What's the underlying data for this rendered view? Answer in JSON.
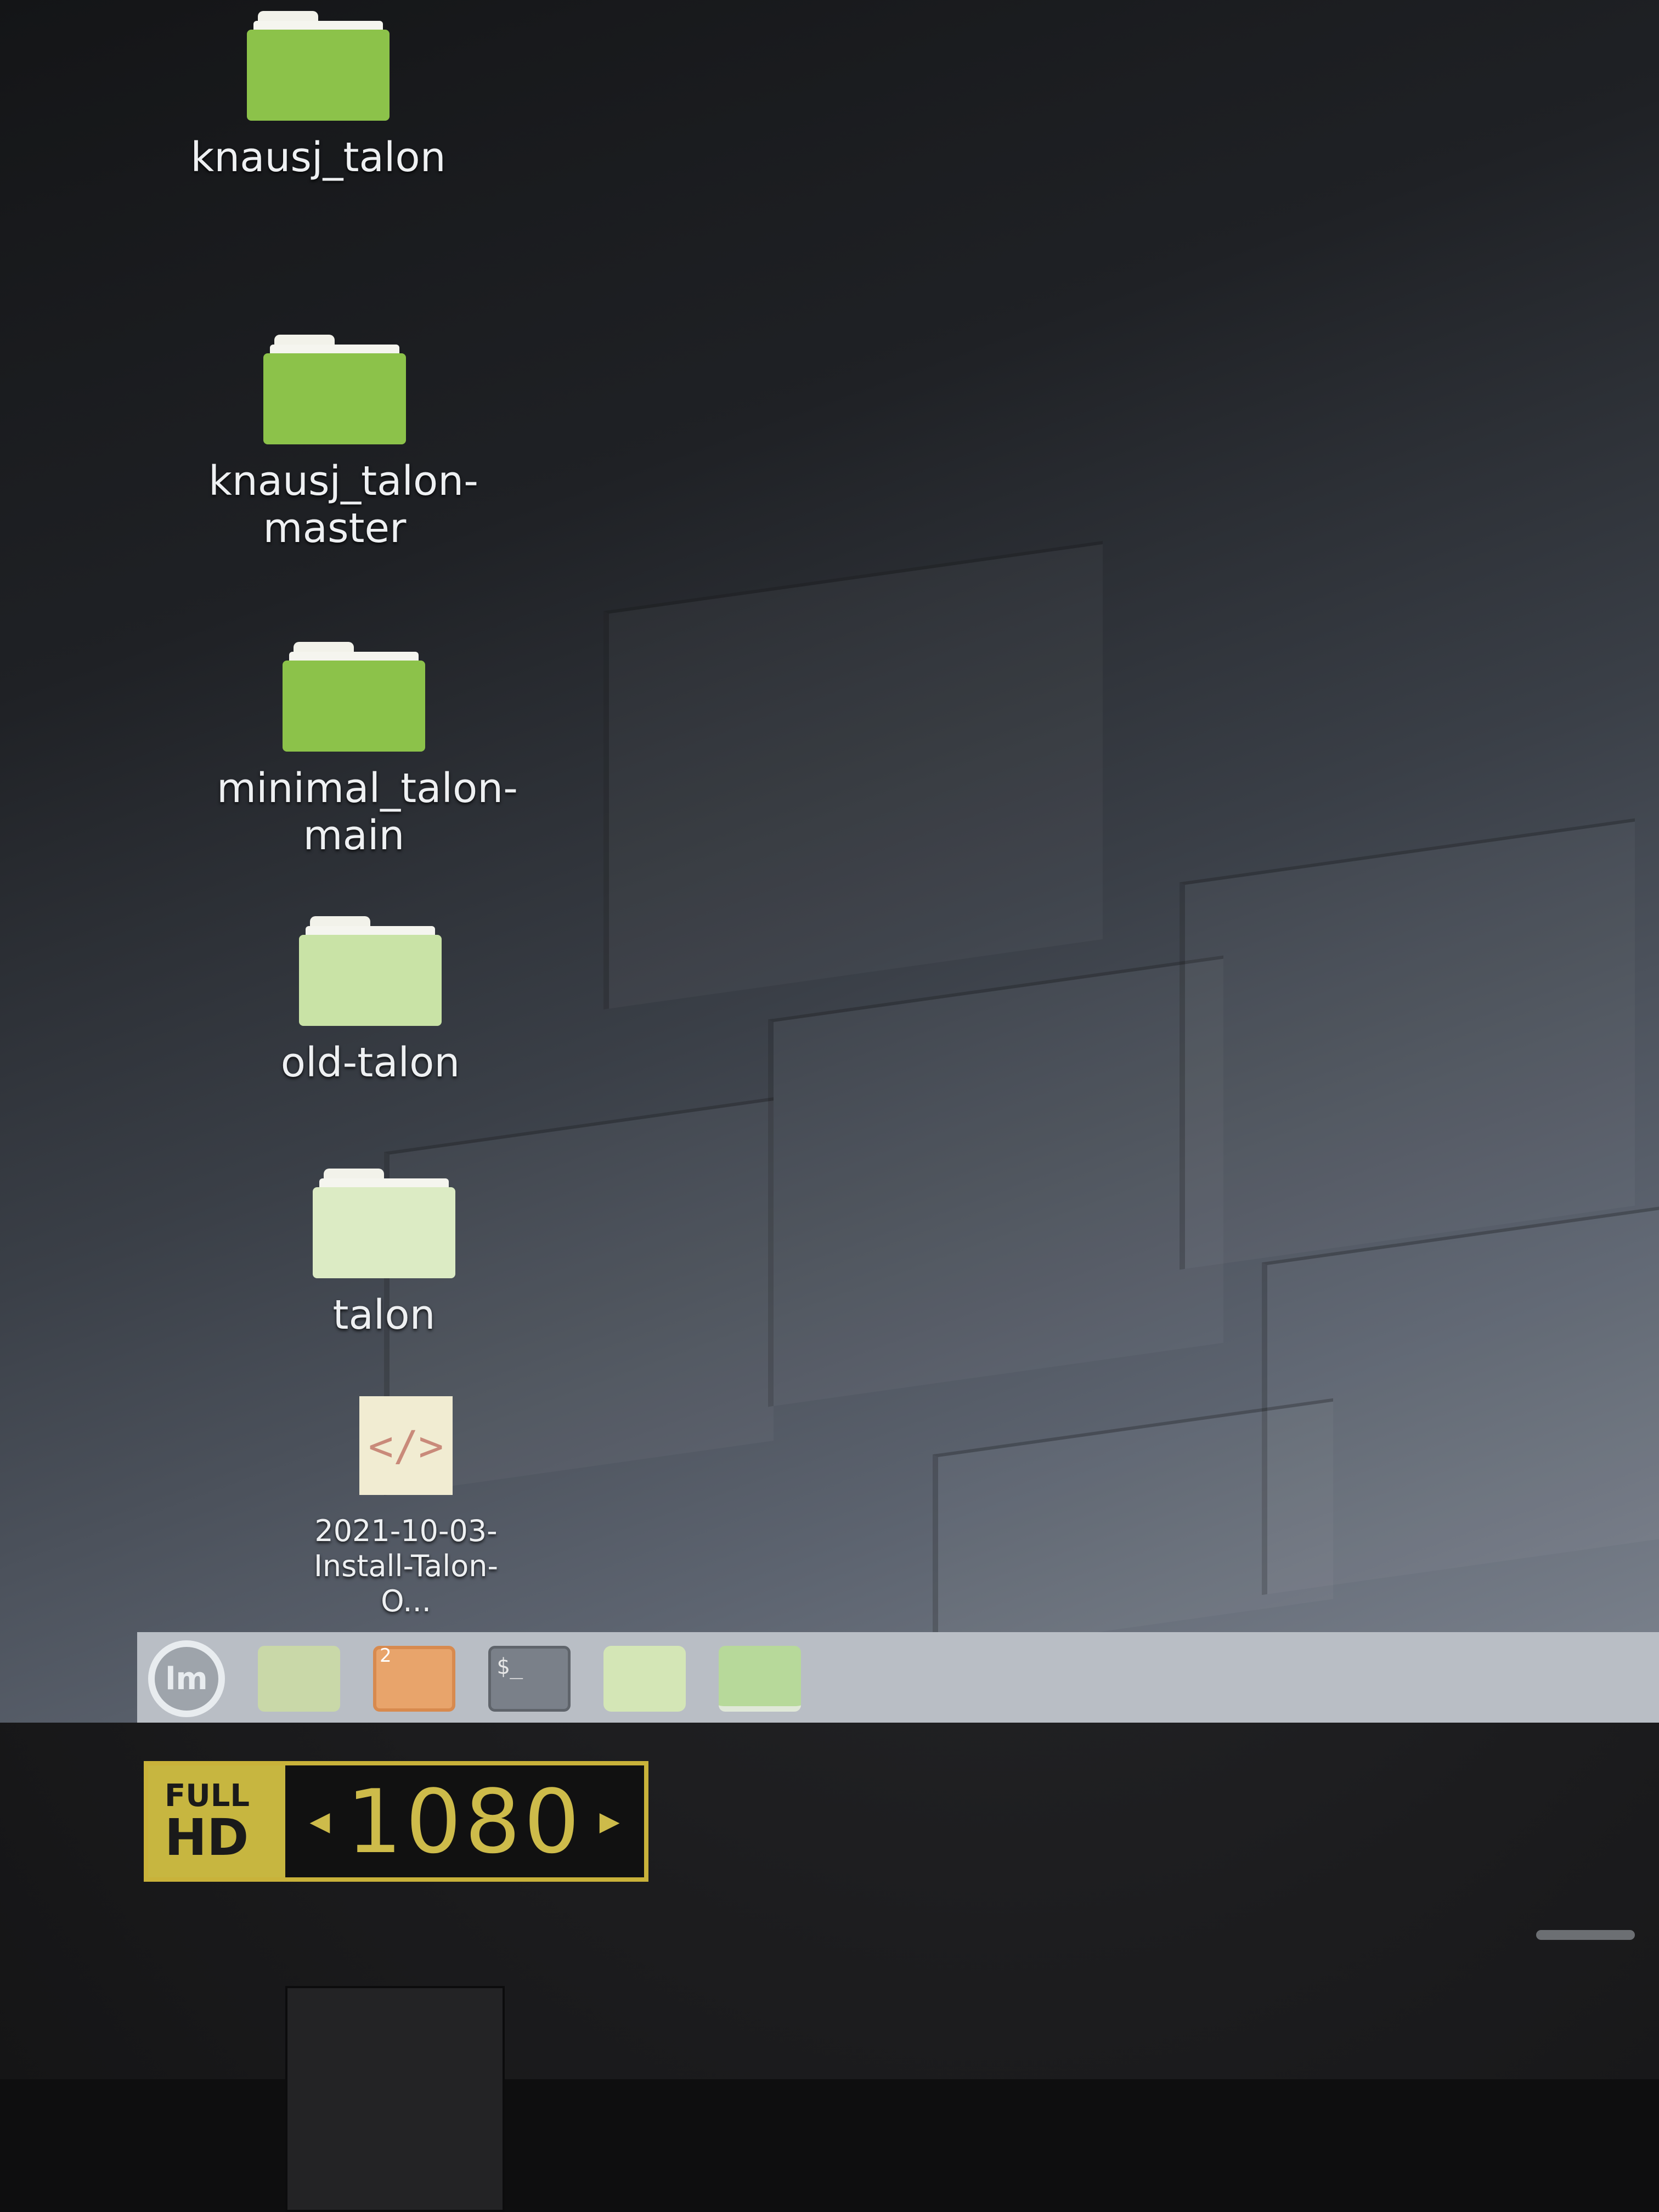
{
  "desktop": {
    "icons": [
      {
        "label": "knausj_talon",
        "type": "folder"
      },
      {
        "label": "knausj_talon-master",
        "type": "folder"
      },
      {
        "label": "minimal_talon-main",
        "type": "folder"
      },
      {
        "label": "old-talon",
        "type": "folder"
      },
      {
        "label": "talon",
        "type": "folder"
      },
      {
        "label": "2021-10-03-Install-Talon-O...",
        "type": "html-file",
        "glyph": "</>"
      }
    ]
  },
  "taskbar": {
    "menu_glyph": "lm",
    "firefox_badge": "2",
    "terminal_glyph": "$_",
    "items": [
      "mint-menu-icon",
      "files-icon",
      "firefox-icon",
      "terminal-icon",
      "folder-icon",
      "active-window-icon"
    ]
  },
  "sticker": {
    "full": "FULL",
    "hd": "HD",
    "resolution": "1080",
    "arrow_left": "◀",
    "arrow_right": "▶"
  },
  "colors": {
    "folder_green": "#8cc24a",
    "panel": "#b9bec5",
    "sticker_gold": "#c7b640"
  }
}
